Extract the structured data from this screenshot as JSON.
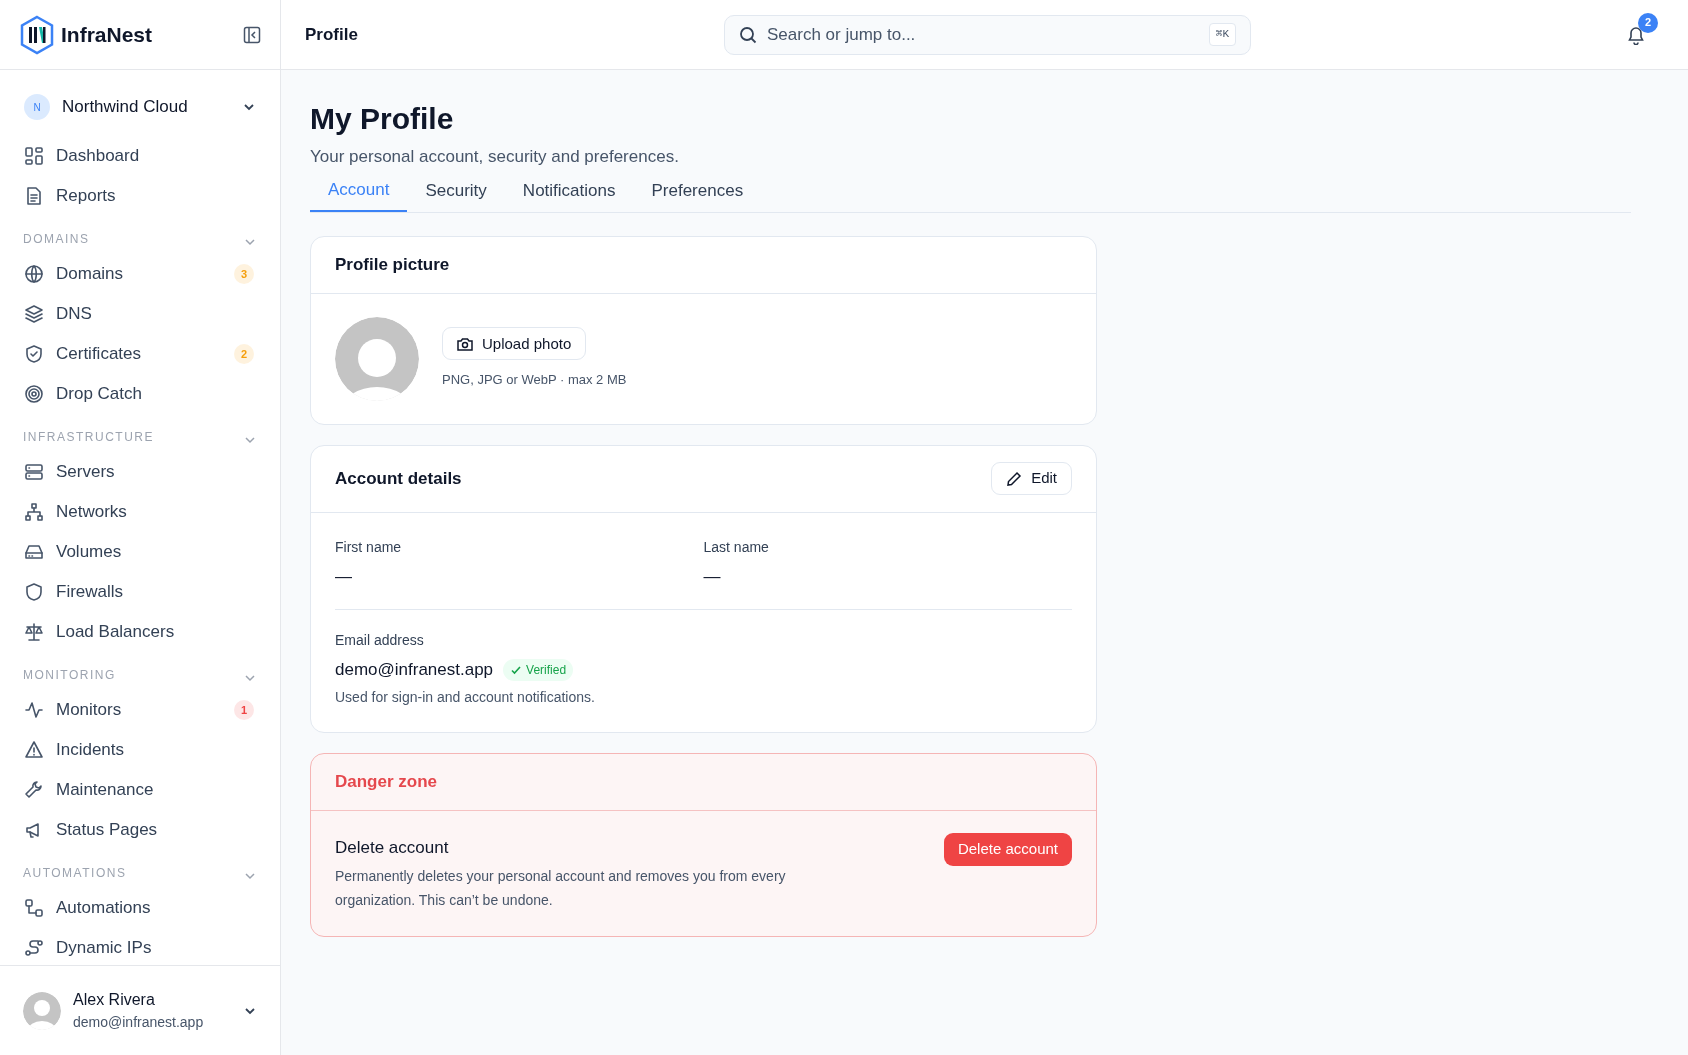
{
  "app": {
    "name": "InfraNest"
  },
  "workspace": {
    "initial": "N",
    "name": "Northwind Cloud"
  },
  "nav": [
    {
      "items": [
        {
          "label": "Dashboard",
          "selected": false
        },
        {
          "label": "Reports",
          "selected": false
        }
      ]
    },
    {
      "heading": "DOMAINS",
      "expanded": true,
      "items": [
        {
          "label": "Domains",
          "selected": false,
          "badge": "3",
          "color": "#f59e0b"
        },
        {
          "label": "DNS",
          "selected": false
        },
        {
          "label": "Certificates",
          "selected": false,
          "badge": "2",
          "color": "#f59e0b"
        },
        {
          "label": "Drop Catch",
          "selected": false
        }
      ]
    },
    {
      "heading": "INFRASTRUCTURE",
      "expanded": true,
      "items": [
        {
          "label": "Servers",
          "selected": false
        },
        {
          "label": "Networks",
          "selected": false
        },
        {
          "label": "Volumes",
          "selected": false
        },
        {
          "label": "Firewalls",
          "selected": false
        },
        {
          "label": "Load Balancers",
          "selected": false
        }
      ]
    },
    {
      "heading": "MONITORING",
      "expanded": true,
      "items": [
        {
          "label": "Monitors",
          "selected": false,
          "badge": "1",
          "color": "#ef4444"
        },
        {
          "label": "Incidents",
          "selected": false
        },
        {
          "label": "Maintenance",
          "selected": false
        },
        {
          "label": "Status Pages",
          "selected": false
        }
      ]
    },
    {
      "heading": "AUTOMATIONS",
      "expanded": true,
      "items": [
        {
          "label": "Automations",
          "selected": false
        },
        {
          "label": "Dynamic IPs",
          "selected": false
        }
      ]
    }
  ],
  "user": {
    "name": "Alex Rivera",
    "email": "demo@infranest.app"
  },
  "header": {
    "title": "Profile",
    "search": {
      "placeholder": "Search or jump to...",
      "shortcut": "⌘K"
    },
    "notifications": "2"
  },
  "page": {
    "title": "My Profile",
    "subtitle": "Your personal account, security and preferences.",
    "tabs": [
      {
        "label": "Account",
        "selected": true
      },
      {
        "label": "Security",
        "selected": false
      },
      {
        "label": "Notifications",
        "selected": false
      },
      {
        "label": "Preferences",
        "selected": false
      }
    ]
  },
  "profile_picture": {
    "title": "Profile picture",
    "button": "Upload photo",
    "hint": "PNG, JPG or WebP · max 2 MB"
  },
  "account_details": {
    "title": "Account details",
    "edit": "Edit",
    "names": [
      {
        "label": "First name",
        "value": "—"
      },
      {
        "label": "Last name",
        "value": "—"
      }
    ],
    "email": {
      "label": "Email address",
      "value": "demo@infranest.app",
      "verified": true,
      "badge": "Verified",
      "note": "Used for sign-in and account notifications."
    }
  },
  "danger_zone": {
    "title": "Danger zone",
    "action": "Delete account",
    "description": "Permanently deletes your personal account and removes you from every organization. This can’t be undone.",
    "button": "Delete account"
  }
}
